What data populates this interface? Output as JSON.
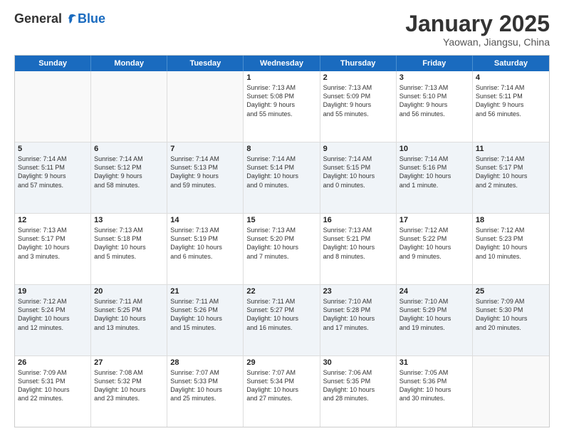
{
  "header": {
    "logo_general": "General",
    "logo_blue": "Blue",
    "month_title": "January 2025",
    "location": "Yaowan, Jiangsu, China"
  },
  "day_headers": [
    "Sunday",
    "Monday",
    "Tuesday",
    "Wednesday",
    "Thursday",
    "Friday",
    "Saturday"
  ],
  "rows": [
    [
      {
        "date": "",
        "info": ""
      },
      {
        "date": "",
        "info": ""
      },
      {
        "date": "",
        "info": ""
      },
      {
        "date": "1",
        "info": "Sunrise: 7:13 AM\nSunset: 5:08 PM\nDaylight: 9 hours\nand 55 minutes."
      },
      {
        "date": "2",
        "info": "Sunrise: 7:13 AM\nSunset: 5:09 PM\nDaylight: 9 hours\nand 55 minutes."
      },
      {
        "date": "3",
        "info": "Sunrise: 7:13 AM\nSunset: 5:10 PM\nDaylight: 9 hours\nand 56 minutes."
      },
      {
        "date": "4",
        "info": "Sunrise: 7:14 AM\nSunset: 5:11 PM\nDaylight: 9 hours\nand 56 minutes."
      }
    ],
    [
      {
        "date": "5",
        "info": "Sunrise: 7:14 AM\nSunset: 5:11 PM\nDaylight: 9 hours\nand 57 minutes."
      },
      {
        "date": "6",
        "info": "Sunrise: 7:14 AM\nSunset: 5:12 PM\nDaylight: 9 hours\nand 58 minutes."
      },
      {
        "date": "7",
        "info": "Sunrise: 7:14 AM\nSunset: 5:13 PM\nDaylight: 9 hours\nand 59 minutes."
      },
      {
        "date": "8",
        "info": "Sunrise: 7:14 AM\nSunset: 5:14 PM\nDaylight: 10 hours\nand 0 minutes."
      },
      {
        "date": "9",
        "info": "Sunrise: 7:14 AM\nSunset: 5:15 PM\nDaylight: 10 hours\nand 0 minutes."
      },
      {
        "date": "10",
        "info": "Sunrise: 7:14 AM\nSunset: 5:16 PM\nDaylight: 10 hours\nand 1 minute."
      },
      {
        "date": "11",
        "info": "Sunrise: 7:14 AM\nSunset: 5:17 PM\nDaylight: 10 hours\nand 2 minutes."
      }
    ],
    [
      {
        "date": "12",
        "info": "Sunrise: 7:13 AM\nSunset: 5:17 PM\nDaylight: 10 hours\nand 3 minutes."
      },
      {
        "date": "13",
        "info": "Sunrise: 7:13 AM\nSunset: 5:18 PM\nDaylight: 10 hours\nand 5 minutes."
      },
      {
        "date": "14",
        "info": "Sunrise: 7:13 AM\nSunset: 5:19 PM\nDaylight: 10 hours\nand 6 minutes."
      },
      {
        "date": "15",
        "info": "Sunrise: 7:13 AM\nSunset: 5:20 PM\nDaylight: 10 hours\nand 7 minutes."
      },
      {
        "date": "16",
        "info": "Sunrise: 7:13 AM\nSunset: 5:21 PM\nDaylight: 10 hours\nand 8 minutes."
      },
      {
        "date": "17",
        "info": "Sunrise: 7:12 AM\nSunset: 5:22 PM\nDaylight: 10 hours\nand 9 minutes."
      },
      {
        "date": "18",
        "info": "Sunrise: 7:12 AM\nSunset: 5:23 PM\nDaylight: 10 hours\nand 10 minutes."
      }
    ],
    [
      {
        "date": "19",
        "info": "Sunrise: 7:12 AM\nSunset: 5:24 PM\nDaylight: 10 hours\nand 12 minutes."
      },
      {
        "date": "20",
        "info": "Sunrise: 7:11 AM\nSunset: 5:25 PM\nDaylight: 10 hours\nand 13 minutes."
      },
      {
        "date": "21",
        "info": "Sunrise: 7:11 AM\nSunset: 5:26 PM\nDaylight: 10 hours\nand 15 minutes."
      },
      {
        "date": "22",
        "info": "Sunrise: 7:11 AM\nSunset: 5:27 PM\nDaylight: 10 hours\nand 16 minutes."
      },
      {
        "date": "23",
        "info": "Sunrise: 7:10 AM\nSunset: 5:28 PM\nDaylight: 10 hours\nand 17 minutes."
      },
      {
        "date": "24",
        "info": "Sunrise: 7:10 AM\nSunset: 5:29 PM\nDaylight: 10 hours\nand 19 minutes."
      },
      {
        "date": "25",
        "info": "Sunrise: 7:09 AM\nSunset: 5:30 PM\nDaylight: 10 hours\nand 20 minutes."
      }
    ],
    [
      {
        "date": "26",
        "info": "Sunrise: 7:09 AM\nSunset: 5:31 PM\nDaylight: 10 hours\nand 22 minutes."
      },
      {
        "date": "27",
        "info": "Sunrise: 7:08 AM\nSunset: 5:32 PM\nDaylight: 10 hours\nand 23 minutes."
      },
      {
        "date": "28",
        "info": "Sunrise: 7:07 AM\nSunset: 5:33 PM\nDaylight: 10 hours\nand 25 minutes."
      },
      {
        "date": "29",
        "info": "Sunrise: 7:07 AM\nSunset: 5:34 PM\nDaylight: 10 hours\nand 27 minutes."
      },
      {
        "date": "30",
        "info": "Sunrise: 7:06 AM\nSunset: 5:35 PM\nDaylight: 10 hours\nand 28 minutes."
      },
      {
        "date": "31",
        "info": "Sunrise: 7:05 AM\nSunset: 5:36 PM\nDaylight: 10 hours\nand 30 minutes."
      },
      {
        "date": "",
        "info": ""
      }
    ]
  ]
}
